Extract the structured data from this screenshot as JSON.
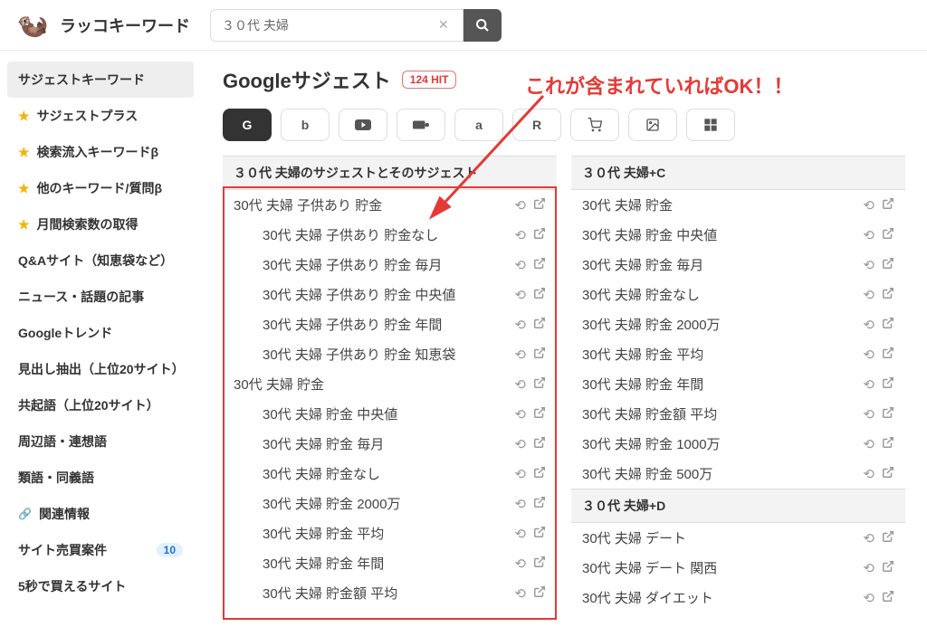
{
  "header": {
    "brand": "ラッコキーワード",
    "search_value": "３０代 夫婦"
  },
  "sidebar": {
    "items": [
      {
        "label": "サジェストキーワード",
        "star": false,
        "active": true
      },
      {
        "label": "サジェストプラス",
        "star": true
      },
      {
        "label": "検索流入キーワードβ",
        "star": true
      },
      {
        "label": "他のキーワード/質問β",
        "star": true
      },
      {
        "label": "月間検索数の取得",
        "star": true
      },
      {
        "label": "Q&Aサイト（知恵袋など）"
      },
      {
        "label": "ニュース・話題の記事"
      },
      {
        "label": "Googleトレンド"
      },
      {
        "label": "見出し抽出（上位20サイト）"
      },
      {
        "label": "共起語（上位20サイト）"
      },
      {
        "label": "周辺語・連想語"
      },
      {
        "label": "類語・同義語"
      },
      {
        "label": "関連情報",
        "link": true
      },
      {
        "label": "サイト売買案件",
        "badge": "10"
      },
      {
        "label": "5秒で買えるサイト"
      }
    ]
  },
  "page": {
    "title": "Googleサジェスト",
    "hit_count": "124 HIT"
  },
  "engines": [
    "G",
    "b",
    "▶",
    "■",
    "a",
    "R",
    "🛒",
    "🖼",
    "⊞"
  ],
  "annotation": "これが含まれていればOK！！",
  "columns": [
    {
      "header": "３０代 夫婦のサジェストとそのサジェスト",
      "rows": [
        {
          "text": "30代 夫婦 子供あり 貯金",
          "indent": 0
        },
        {
          "text": "30代 夫婦 子供あり 貯金なし",
          "indent": 1
        },
        {
          "text": "30代 夫婦 子供あり 貯金 毎月",
          "indent": 1
        },
        {
          "text": "30代 夫婦 子供あり 貯金 中央値",
          "indent": 1
        },
        {
          "text": "30代 夫婦 子供あり 貯金 年間",
          "indent": 1
        },
        {
          "text": "30代 夫婦 子供あり 貯金 知恵袋",
          "indent": 1
        },
        {
          "text": "30代 夫婦 貯金",
          "indent": 0
        },
        {
          "text": "30代 夫婦 貯金 中央値",
          "indent": 1
        },
        {
          "text": "30代 夫婦 貯金 毎月",
          "indent": 1
        },
        {
          "text": "30代 夫婦 貯金なし",
          "indent": 1
        },
        {
          "text": "30代 夫婦 貯金 2000万",
          "indent": 1
        },
        {
          "text": "30代 夫婦 貯金 平均",
          "indent": 1
        },
        {
          "text": "30代 夫婦 貯金 年間",
          "indent": 1
        },
        {
          "text": "30代 夫婦 貯金額 平均",
          "indent": 1
        }
      ]
    },
    {
      "sections": [
        {
          "header": "３０代 夫婦+C",
          "rows": [
            {
              "text": "30代 夫婦 貯金"
            },
            {
              "text": "30代 夫婦 貯金 中央値"
            },
            {
              "text": "30代 夫婦 貯金 毎月"
            },
            {
              "text": "30代 夫婦 貯金なし"
            },
            {
              "text": "30代 夫婦 貯金 2000万"
            },
            {
              "text": "30代 夫婦 貯金 平均"
            },
            {
              "text": "30代 夫婦 貯金 年間"
            },
            {
              "text": "30代 夫婦 貯金額 平均"
            },
            {
              "text": "30代 夫婦 貯金 1000万"
            },
            {
              "text": "30代 夫婦 貯金 500万"
            }
          ]
        },
        {
          "header": "３０代 夫婦+D",
          "rows": [
            {
              "text": "30代 夫婦 デート"
            },
            {
              "text": "30代 夫婦 デート 関西"
            },
            {
              "text": "30代 夫婦 ダイエット"
            }
          ]
        }
      ]
    }
  ]
}
